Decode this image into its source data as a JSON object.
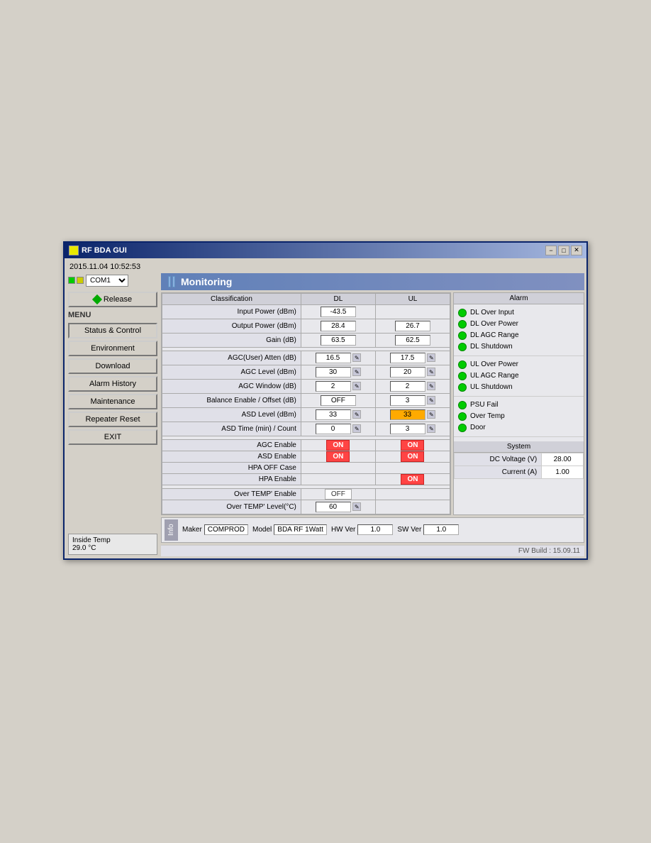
{
  "window": {
    "title": "RF BDA GUI",
    "datetime": "2015.11.04  10:52:53",
    "min_btn": "−",
    "max_btn": "□",
    "close_btn": "✕"
  },
  "sidebar": {
    "com_port": "COM1",
    "release_label": "Release",
    "menu_label": "MENU",
    "buttons": [
      {
        "id": "status",
        "label": "Status & Control"
      },
      {
        "id": "environment",
        "label": "Environment"
      },
      {
        "id": "download",
        "label": "Download"
      },
      {
        "id": "alarm_history",
        "label": "Alarm History"
      },
      {
        "id": "maintenance",
        "label": "Maintenance"
      },
      {
        "id": "repeater_reset",
        "label": "Repeater Reset"
      },
      {
        "id": "exit",
        "label": "EXIT"
      }
    ],
    "inside_temp_label": "Inside Temp",
    "inside_temp_value": "29.0 °C"
  },
  "monitoring": {
    "title": "Monitoring",
    "table": {
      "headers": [
        "Classification",
        "DL",
        "UL"
      ],
      "rows": [
        {
          "label": "Input Power (dBm)",
          "dl": "-43.5",
          "ul": ""
        },
        {
          "label": "Output Power (dBm)",
          "dl": "28.4",
          "ul": "26.7"
        },
        {
          "label": "Gain (dB)",
          "dl": "63.5",
          "ul": "62.5"
        }
      ],
      "agc_rows": [
        {
          "label": "AGC(User) Atten (dB)",
          "dl": "16.5",
          "ul": "17.5"
        },
        {
          "label": "AGC Level (dBm)",
          "dl": "30",
          "ul": "20"
        },
        {
          "label": "AGC Window (dB)",
          "dl": "2",
          "ul": "2"
        },
        {
          "label": "Balance Enable / Offset (dB)",
          "dl": "OFF",
          "ul": "3"
        },
        {
          "label": "ASD Level (dBm)",
          "dl": "33",
          "ul": "33"
        },
        {
          "label": "ASD Time (min) / Count",
          "dl": "0",
          "ul": "3"
        }
      ],
      "enable_rows": [
        {
          "label": "AGC Enable",
          "dl": "ON",
          "ul": "ON"
        },
        {
          "label": "ASD Enable",
          "dl": "ON",
          "ul": "ON"
        },
        {
          "label": "HPA OFF Case",
          "dl": "",
          "ul": ""
        },
        {
          "label": "HPA Enable",
          "dl": "",
          "ul": "ON"
        }
      ],
      "temp_rows": [
        {
          "label": "Over TEMP' Enable",
          "dl": "OFF",
          "ul": ""
        },
        {
          "label": "Over TEMP' Level(°C)",
          "dl": "60",
          "ul": ""
        }
      ]
    }
  },
  "alarm": {
    "title": "Alarm",
    "dl_items": [
      {
        "label": "DL Over Input",
        "status": "green"
      },
      {
        "label": "DL Over Power",
        "status": "green"
      },
      {
        "label": "DL AGC Range",
        "status": "green"
      },
      {
        "label": "DL Shutdown",
        "status": "green"
      }
    ],
    "ul_items": [
      {
        "label": "UL Over Power",
        "status": "green"
      },
      {
        "label": "UL AGC Range",
        "status": "green"
      },
      {
        "label": "UL Shutdown",
        "status": "green"
      }
    ],
    "sys_items": [
      {
        "label": "PSU Fail",
        "status": "green"
      },
      {
        "label": "Over Temp",
        "status": "green"
      },
      {
        "label": "Door",
        "status": "green"
      }
    ]
  },
  "system": {
    "title": "System",
    "dc_voltage_label": "DC Voltage (V)",
    "dc_voltage_value": "28.00",
    "current_label": "Current (A)",
    "current_value": "1.00"
  },
  "info_bar": {
    "tab_label": "Info",
    "maker_label": "Maker",
    "maker_value": "COMPROD",
    "model_label": "Model",
    "model_value": "BDA RF 1Watt",
    "hw_ver_label": "HW Ver",
    "hw_ver_value": "1.0",
    "sw_ver_label": "SW Ver",
    "sw_ver_value": "1.0"
  },
  "footer": {
    "fw_build": "FW Build : 15.09.11"
  }
}
